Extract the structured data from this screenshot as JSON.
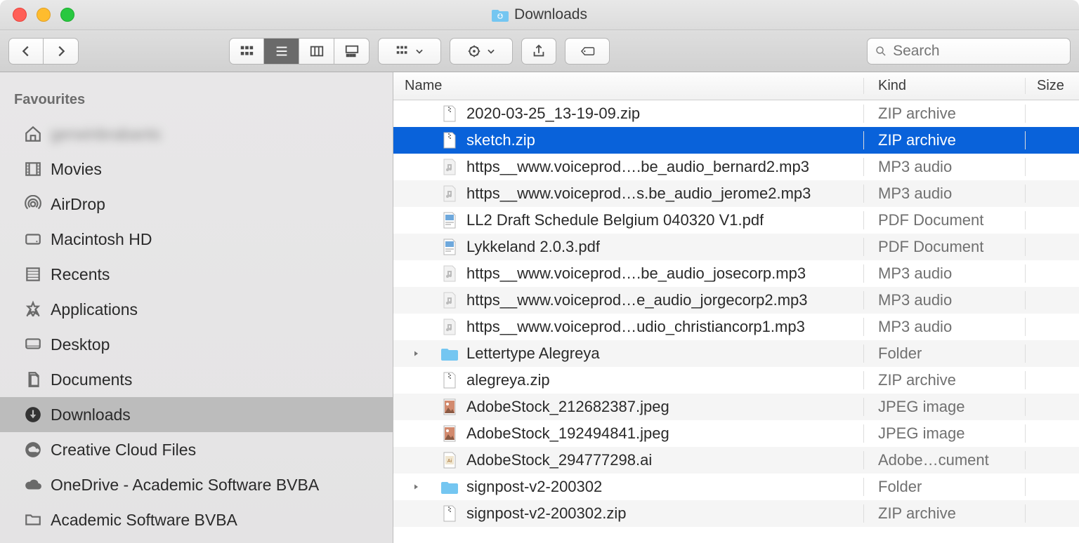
{
  "title": "Downloads",
  "search_placeholder": "Search",
  "sidebar": {
    "heading": "Favourites",
    "items": [
      {
        "id": "home",
        "label": "gerwinbrabants",
        "icon": "house",
        "blur": true
      },
      {
        "id": "movies",
        "label": "Movies",
        "icon": "film"
      },
      {
        "id": "airdrop",
        "label": "AirDrop",
        "icon": "airdrop"
      },
      {
        "id": "macintoshhd",
        "label": "Macintosh HD",
        "icon": "hdd"
      },
      {
        "id": "recents",
        "label": "Recents",
        "icon": "recents"
      },
      {
        "id": "applications",
        "label": "Applications",
        "icon": "apps"
      },
      {
        "id": "desktop",
        "label": "Desktop",
        "icon": "desktop"
      },
      {
        "id": "documents",
        "label": "Documents",
        "icon": "documents"
      },
      {
        "id": "downloads",
        "label": "Downloads",
        "icon": "downloads",
        "active": true
      },
      {
        "id": "ccf",
        "label": "Creative Cloud Files",
        "icon": "cc"
      },
      {
        "id": "onedrive",
        "label": "OneDrive - Academic Software BVBA",
        "icon": "cloud"
      },
      {
        "id": "asb",
        "label": "Academic Software BVBA",
        "icon": "folder"
      }
    ]
  },
  "columns": {
    "name": "Name",
    "kind": "Kind",
    "size": "Size"
  },
  "files": [
    {
      "name": "2020-03-25_13-19-09.zip",
      "kind": "ZIP archive",
      "icon": "zip"
    },
    {
      "name": "sketch.zip",
      "kind": "ZIP archive",
      "icon": "zip",
      "selected": true
    },
    {
      "name": "https__www.voiceprod….be_audio_bernard2.mp3",
      "kind": "MP3 audio",
      "icon": "audio"
    },
    {
      "name": "https__www.voiceprod…s.be_audio_jerome2.mp3",
      "kind": "MP3 audio",
      "icon": "audio"
    },
    {
      "name": "LL2 Draft Schedule Belgium 040320 V1.pdf",
      "kind": "PDF Document",
      "icon": "pdf"
    },
    {
      "name": "Lykkeland 2.0.3.pdf",
      "kind": "PDF Document",
      "icon": "pdf"
    },
    {
      "name": "https__www.voiceprod….be_audio_josecorp.mp3",
      "kind": "MP3 audio",
      "icon": "audio"
    },
    {
      "name": "https__www.voiceprod…e_audio_jorgecorp2.mp3",
      "kind": "MP3 audio",
      "icon": "audio"
    },
    {
      "name": "https__www.voiceprod…udio_christiancorp1.mp3",
      "kind": "MP3 audio",
      "icon": "audio"
    },
    {
      "name": "Lettertype Alegreya",
      "kind": "Folder",
      "icon": "folder",
      "expandable": true
    },
    {
      "name": "alegreya.zip",
      "kind": "ZIP archive",
      "icon": "zip"
    },
    {
      "name": "AdobeStock_212682387.jpeg",
      "kind": "JPEG image",
      "icon": "jpeg"
    },
    {
      "name": "AdobeStock_192494841.jpeg",
      "kind": "JPEG image",
      "icon": "jpeg"
    },
    {
      "name": "AdobeStock_294777298.ai",
      "kind": "Adobe…cument",
      "icon": "ai"
    },
    {
      "name": "signpost-v2-200302",
      "kind": "Folder",
      "icon": "folder",
      "expandable": true
    },
    {
      "name": "signpost-v2-200302.zip",
      "kind": "ZIP archive",
      "icon": "zip"
    }
  ]
}
